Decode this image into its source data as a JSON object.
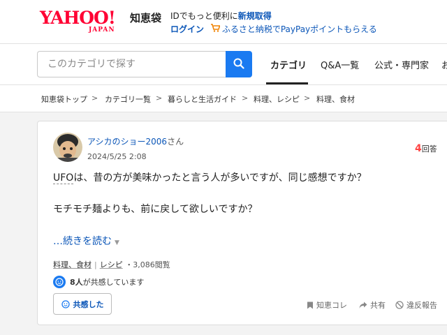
{
  "brand": {
    "logo_main": "YAHOO!",
    "logo_sub": "JAPAN",
    "service": "知恵袋"
  },
  "promo": {
    "line1_text": "IDでもっと便利に",
    "line1_link": "新規取得",
    "login": "ログイン",
    "line2_text": "ふるさと納税でPayPayポイントもらえる"
  },
  "search": {
    "placeholder": "このカテゴリで探す",
    "icon": "search-icon"
  },
  "nav": [
    {
      "label": "カテゴリ",
      "active": true
    },
    {
      "label": "Q&A一覧"
    },
    {
      "label": "公式・専門家"
    },
    {
      "label": "お"
    }
  ],
  "breadcrumb": [
    "知恵袋トップ",
    "カテゴリ一覧",
    "暮らしと生活ガイド",
    "料理、レシピ",
    "料理、食材"
  ],
  "breadcrumb_separator": ">",
  "question": {
    "user": "アシカのショー2006",
    "honorific": "さん",
    "date": "2024/5/25 2:08",
    "answer_count": "4",
    "answer_unit": "回答",
    "body_term": "UFO",
    "body_line1_rest": "は、昔の方が美味かったと言う人が多いですが、同じ感想ですか？",
    "body_line2": "モチモチ麺よりも、前に戻して欲しいですか？",
    "readmore": "…続きを読む",
    "tag1": "料理、食材",
    "tag2": "レシピ",
    "views": "3,086閲覧",
    "empathy_count": "8人",
    "empathy_text": "が共感しています",
    "empathy_button": "共感した",
    "actions": {
      "save": "知恵コレ",
      "share": "共有",
      "report": "違反報告"
    }
  },
  "colors": {
    "brand_red": "#ff0033",
    "link_blue": "#0b56b8",
    "accent_blue": "#1a7af1",
    "answer_red": "#ff4443"
  }
}
